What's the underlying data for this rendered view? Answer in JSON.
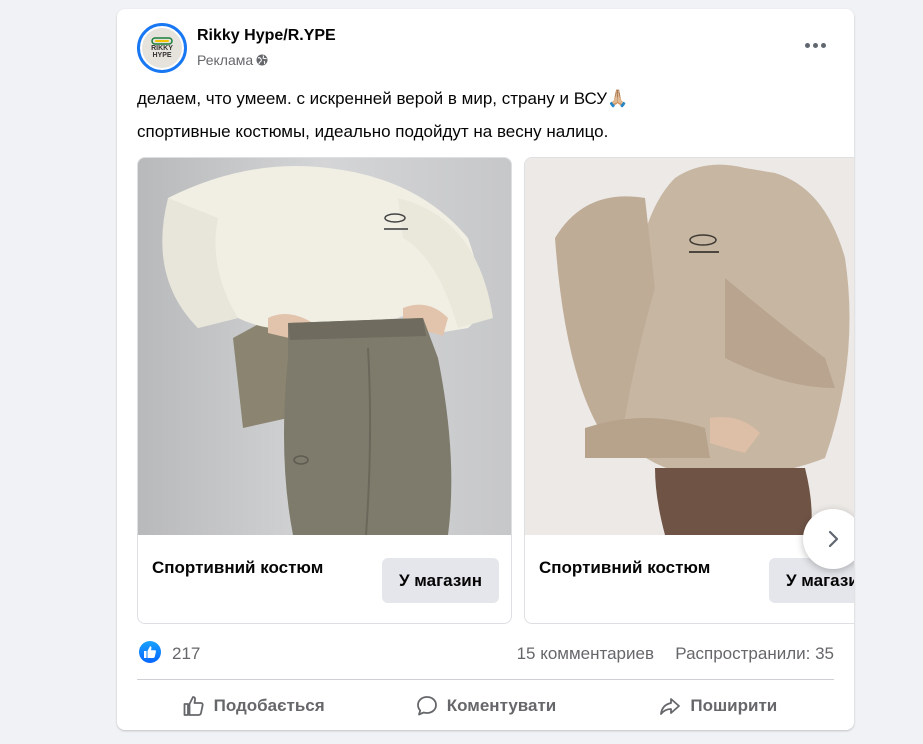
{
  "post": {
    "author": "Rikky Hype/R.YPE",
    "sponsored_label": "Реклама",
    "avatar_text_line1": "RIKKY",
    "avatar_text_line2": "HYPE",
    "text_line1": "делаем, что умеем. с искренней верой в мир, страну и ВСУ🙏🏼",
    "text_line2": "спортивные костюмы, идеально подойдут на весну налицо."
  },
  "carousel": {
    "items": [
      {
        "caption": "Спортивний костюм",
        "button_label": "У магазин"
      },
      {
        "caption": "Спортивний костюм",
        "button_label": "У магазин"
      }
    ]
  },
  "stats": {
    "likes": "217",
    "comments": "15 комментариев",
    "shares": "Распространили: 35"
  },
  "actions": {
    "like": "Подобається",
    "comment": "Коментувати",
    "share": "Поширити"
  }
}
